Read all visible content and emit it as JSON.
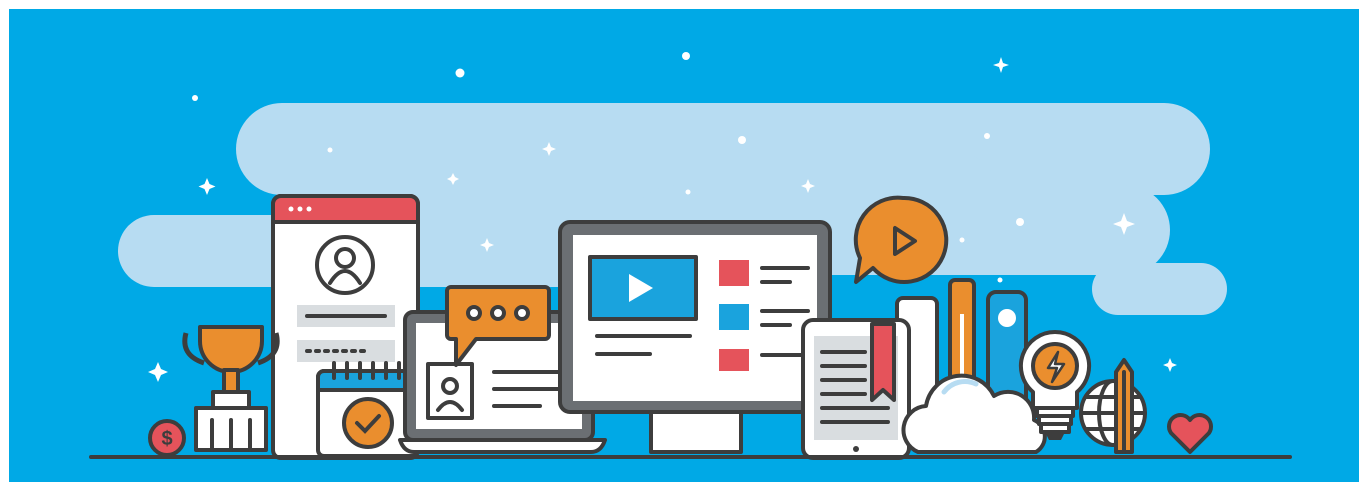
{
  "banner": {
    "background_color": "#00a9e6",
    "cloud_color": "#b7dcf2",
    "outline_color": "#3d3d3d",
    "accent_orange": "#ea8e2e",
    "accent_red": "#e5535b",
    "accent_blue": "#1aa3dd"
  },
  "icons": [
    "trophy-icon",
    "coin-dollar-icon",
    "profile-card-icon",
    "user-avatar-icon",
    "calendar-check-icon",
    "laptop-icon",
    "chat-bubble-icon",
    "desktop-monitor-icon",
    "play-video-icon",
    "play-speech-bubble-icon",
    "tablet-ebook-icon",
    "bookmark-icon",
    "cloud-icon",
    "lightbulb-icon",
    "lightning-icon",
    "globe-icon",
    "pencil-icon",
    "heart-icon",
    "sparkle-icon"
  ]
}
